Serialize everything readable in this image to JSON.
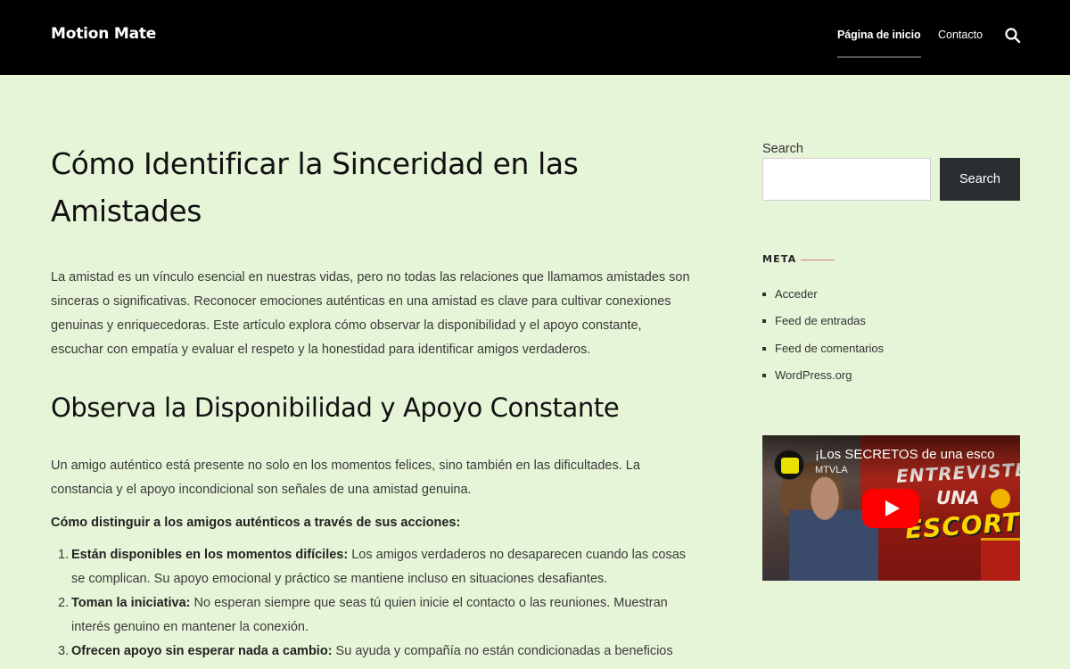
{
  "header": {
    "site_title": "Motion Mate",
    "nav": [
      {
        "label": "Página de inicio",
        "active": true
      },
      {
        "label": "Contacto",
        "active": false
      }
    ],
    "search_icon": "search-icon"
  },
  "article": {
    "title": "Cómo Identificar la Sinceridad en las Amistades",
    "intro": "La amistad es un vínculo esencial en nuestras vidas, pero no todas las relaciones que llamamos amistades son sinceras o significativas. Reconocer emociones auténticas en una amistad es clave para cultivar conexiones genuinas y enriquecedoras. Este artículo explora cómo observar la disponibilidad y el apoyo constante, escuchar con empatía y evaluar el respeto y la honestidad para identificar amigos verdaderos.",
    "section_heading": "Observa la Disponibilidad y Apoyo Constante",
    "section_paragraph": "Un amigo auténtico está presente no solo en los momentos felices, sino también en las dificultades. La constancia y el apoyo incondicional son señales de una amistad genuina.",
    "list_intro": "Cómo distinguir a los amigos auténticos a través de sus acciones:",
    "list": [
      {
        "num": "1.",
        "bold": "Están disponibles en los momentos difíciles:",
        "text": " Los amigos verdaderos no desaparecen cuando las cosas se complican. Su apoyo emocional y práctico se mantiene incluso en situaciones desafiantes."
      },
      {
        "num": "2.",
        "bold": "Toman la iniciativa:",
        "text": " No esperan siempre que seas tú quien inicie el contacto o las reuniones. Muestran interés genuino en mantener la conexión."
      },
      {
        "num": "3.",
        "bold": "Ofrecen apoyo sin esperar nada a cambio:",
        "text": " Su ayuda y compañía no están condicionadas a beneficios"
      }
    ]
  },
  "sidebar": {
    "search": {
      "label": "Search",
      "placeholder": "",
      "button_label": "Search"
    },
    "meta": {
      "heading": "META",
      "accent_color": "#d07a7a",
      "items": [
        "Acceder",
        "Feed de entradas",
        "Feed de comentarios",
        "WordPress.org"
      ]
    },
    "video": {
      "title": "¡Los SECRETOS de una esco",
      "channel": "MTVLA",
      "thumbnail_text": [
        "ENTREVISTE",
        "UNA",
        "ESCORT"
      ],
      "play_icon": "play-icon"
    }
  },
  "colors": {
    "background": "#e6f5d8",
    "header": "#000000",
    "button": "#2b2e31"
  }
}
